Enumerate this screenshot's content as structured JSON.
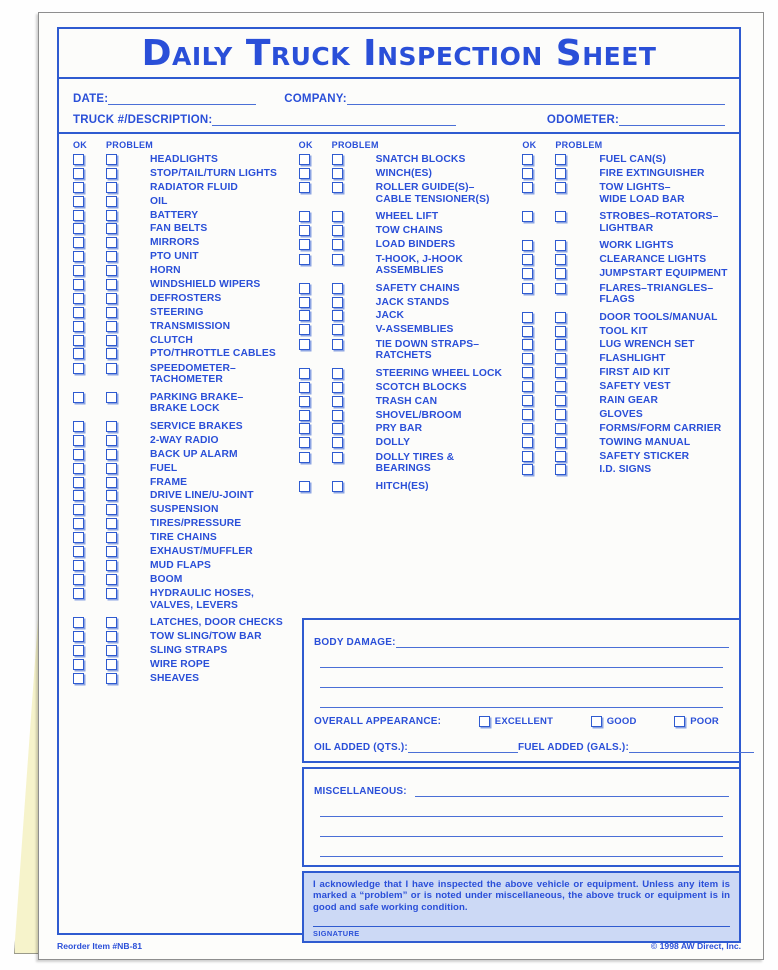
{
  "title": "Daily Truck Inspection Sheet",
  "header": {
    "date_label": "DATE:",
    "company_label": "COMPANY:",
    "truck_label": "TRUCK #/DESCRIPTION:",
    "odometer_label": "ODOMETER:"
  },
  "column_headers": {
    "ok": "OK",
    "problem": "PROBLEM"
  },
  "columns": [
    {
      "items": [
        {
          "label": "HEADLIGHTS"
        },
        {
          "label": "STOP/TAIL/TURN LIGHTS"
        },
        {
          "label": "RADIATOR FLUID"
        },
        {
          "label": "OIL"
        },
        {
          "label": "BATTERY"
        },
        {
          "label": "FAN BELTS"
        },
        {
          "label": "MIRRORS"
        },
        {
          "label": "PTO UNIT"
        },
        {
          "label": "HORN"
        },
        {
          "label": "WINDSHIELD WIPERS"
        },
        {
          "label": "DEFROSTERS"
        },
        {
          "label": "STEERING"
        },
        {
          "label": "TRANSMISSION"
        },
        {
          "label": "CLUTCH"
        },
        {
          "label": "PTO/THROTTLE CABLES"
        },
        {
          "label": "SPEEDOMETER–\nTACHOMETER"
        },
        {
          "label": "PARKING BRAKE–\nBRAKE LOCK"
        },
        {
          "label": "SERVICE BRAKES"
        },
        {
          "label": "2-WAY RADIO"
        },
        {
          "label": "BACK UP ALARM"
        },
        {
          "label": "FUEL"
        },
        {
          "label": "FRAME"
        },
        {
          "label": "DRIVE LINE/U-JOINT"
        },
        {
          "label": "SUSPENSION"
        },
        {
          "label": "TIRES/PRESSURE"
        },
        {
          "label": "TIRE CHAINS"
        },
        {
          "label": "EXHAUST/MUFFLER"
        },
        {
          "label": "MUD FLAPS"
        },
        {
          "label": "BOOM"
        },
        {
          "label": "HYDRAULIC HOSES,\nVALVES, LEVERS"
        },
        {
          "label": "LATCHES, DOOR CHECKS"
        },
        {
          "label": "TOW SLING/TOW BAR"
        },
        {
          "label": "SLING STRAPS"
        },
        {
          "label": "WIRE ROPE"
        },
        {
          "label": "SHEAVES"
        }
      ]
    },
    {
      "items": [
        {
          "label": "SNATCH BLOCKS"
        },
        {
          "label": "WINCH(ES)"
        },
        {
          "label": "ROLLER GUIDE(S)–\nCABLE TENSIONER(S)"
        },
        {
          "label": "WHEEL LIFT"
        },
        {
          "label": "TOW CHAINS"
        },
        {
          "label": "LOAD BINDERS"
        },
        {
          "label": "T-HOOK, J-HOOK\nASSEMBLIES"
        },
        {
          "label": "SAFETY CHAINS"
        },
        {
          "label": "JACK STANDS"
        },
        {
          "label": "JACK"
        },
        {
          "label": "V-ASSEMBLIES"
        },
        {
          "label": "TIE DOWN STRAPS–\nRATCHETS"
        },
        {
          "label": "STEERING WHEEL LOCK"
        },
        {
          "label": "SCOTCH BLOCKS"
        },
        {
          "label": "TRASH CAN"
        },
        {
          "label": "SHOVEL/BROOM"
        },
        {
          "label": "PRY BAR"
        },
        {
          "label": "DOLLY"
        },
        {
          "label": "DOLLY TIRES &\nBEARINGS"
        },
        {
          "label": "HITCH(ES)"
        }
      ]
    },
    {
      "items": [
        {
          "label": "FUEL CAN(S)"
        },
        {
          "label": "FIRE EXTINGUISHER"
        },
        {
          "label": "TOW LIGHTS–\nWIDE LOAD BAR"
        },
        {
          "label": "STROBES–ROTATORS–\nLIGHTBAR"
        },
        {
          "label": "WORK LIGHTS"
        },
        {
          "label": "CLEARANCE LIGHTS"
        },
        {
          "label": "JUMPSTART EQUIPMENT"
        },
        {
          "label": "FLARES–TRIANGLES–\nFLAGS"
        },
        {
          "label": "DOOR TOOLS/MANUAL"
        },
        {
          "label": "TOOL KIT"
        },
        {
          "label": "LUG WRENCH SET"
        },
        {
          "label": "FLASHLIGHT"
        },
        {
          "label": "FIRST AID KIT"
        },
        {
          "label": "SAFETY VEST"
        },
        {
          "label": "RAIN GEAR"
        },
        {
          "label": "GLOVES"
        },
        {
          "label": "FORMS/FORM CARRIER"
        },
        {
          "label": "TOWING MANUAL"
        },
        {
          "label": "SAFETY STICKER"
        },
        {
          "label": "I.D. SIGNS"
        }
      ]
    }
  ],
  "body_damage": {
    "label": "BODY DAMAGE:",
    "appearance_label": "OVERALL APPEARANCE:",
    "options": [
      "EXCELLENT",
      "GOOD",
      "POOR"
    ],
    "oil_added_label": "OIL ADDED (QTS.):",
    "fuel_added_label": "FUEL ADDED (GALS.):"
  },
  "miscellaneous": {
    "label": "MISCELLANEOUS:"
  },
  "acknowledgment": {
    "text": "I acknowledge that I have inspected the above vehicle or equipment. Unless any item is marked a “problem” or is noted under miscellaneous, the above truck or equipment is in good and safe working condition.",
    "signature_caption": "SIGNATURE"
  },
  "footer": {
    "reorder": "Reorder Item #NB-81",
    "copyright": "© 1998 AW Direct, Inc."
  },
  "colors": {
    "blue": "#2a4fd8",
    "border_blue": "#2f5bd0",
    "ack_bg": "#ccd9f5",
    "carbon": "#f6f3cb"
  }
}
